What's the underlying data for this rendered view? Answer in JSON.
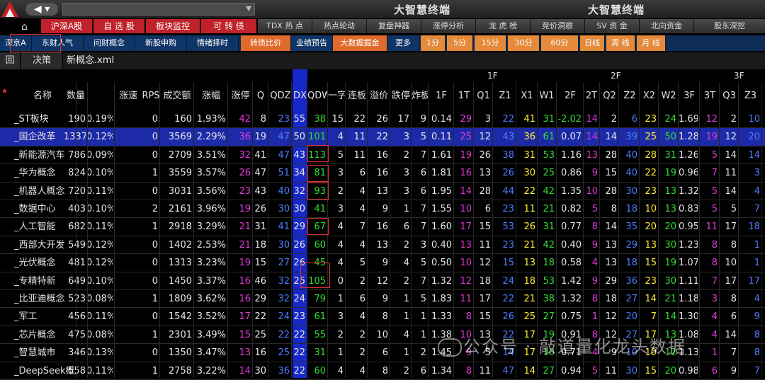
{
  "top": {
    "titles": [
      "大智慧终端",
      "大智慧终端"
    ]
  },
  "tabs_red": [
    "沪深A股",
    "自 选 股",
    "板块监控",
    "可 转 债"
  ],
  "tabs_dark": [
    "TDX 热 点",
    "热点轮动",
    "复盘神器",
    "涨停分析",
    "龙 虎 榜",
    "竞价洞察",
    "SV 资 金",
    "北向资金",
    "股东深挖"
  ],
  "row3": [
    "深京A",
    "东财人气",
    "问财概念",
    "新股申购",
    "情绪择时",
    "转债比价",
    "业绩预告",
    "大数据掘金",
    "更多",
    "1分",
    "5分",
    "15分",
    "30分",
    "60分",
    "日线",
    "周 线",
    "月 线"
  ],
  "row4": {
    "back": "回",
    "decide": "决策",
    "file": "新概念.xml"
  },
  "groups": [
    "1F",
    "2F",
    "3F"
  ],
  "headers": [
    "名称",
    "数量",
    "涨速",
    "RPS",
    "成交额",
    "涨幅",
    "涨停",
    "Q",
    "QDZ",
    "DX",
    "QDW",
    "一字",
    "连板",
    "溢价",
    "跌停",
    "炸板",
    "1F",
    "1T",
    "Q1",
    "Z1",
    "X1",
    "W1",
    "2F",
    "2T",
    "Q2",
    "Z2",
    "X2",
    "W2",
    "3F",
    "3T",
    "Q3",
    "Z3"
  ],
  "rows": [
    [
      "_ST板块",
      "190",
      "0.19%",
      "0",
      "160",
      "1.93%",
      "42",
      "8",
      "23",
      "55",
      "38",
      "15",
      "22",
      "26",
      "17",
      "9",
      "0.14",
      "29",
      "3",
      "22",
      "41",
      "31",
      "-2.02",
      "14",
      "2",
      "6",
      "23",
      "24",
      "1.69",
      "12",
      "2",
      "10"
    ],
    [
      "_国企改革",
      "1337",
      "0.12%",
      "0",
      "3569",
      "2.29%",
      "36",
      "19",
      "47",
      "50",
      "101",
      "4",
      "11",
      "22",
      "3",
      "5",
      "0.11",
      "25",
      "12",
      "43",
      "36",
      "61",
      "0.07",
      "14",
      "14",
      "39",
      "25",
      "50",
      "1.28",
      "19",
      "12",
      "20"
    ],
    [
      "_新能源汽车",
      "786",
      "0.09%",
      "0",
      "2709",
      "3.51%",
      "32",
      "41",
      "47",
      "43",
      "113",
      "5",
      "11",
      "16",
      "2",
      "7",
      "1.61",
      "19",
      "26",
      "38",
      "31",
      "53",
      "1.16",
      "13",
      "28",
      "40",
      "28",
      "31",
      "1.26",
      "5",
      "14",
      "14"
    ],
    [
      "_华为概念",
      "824",
      "0.10%",
      "1",
      "3559",
      "3.57%",
      "26",
      "47",
      "51",
      "34",
      "81",
      "3",
      "6",
      "16",
      "3",
      "6",
      "1.81",
      "16",
      "13",
      "26",
      "30",
      "25",
      "0.86",
      "9",
      "15",
      "40",
      "22",
      "19",
      "0.96",
      "7",
      "11",
      "3"
    ],
    [
      "_机器人概念",
      "720",
      "0.11%",
      "0",
      "3031",
      "3.56%",
      "23",
      "43",
      "40",
      "32",
      "93",
      "2",
      "4",
      "13",
      "3",
      "6",
      "1.95",
      "14",
      "28",
      "44",
      "22",
      "42",
      "1.35",
      "10",
      "28",
      "30",
      "23",
      "13",
      "1.32",
      "5",
      "14",
      "4"
    ],
    [
      "_数据中心",
      "403",
      "0.10%",
      "2",
      "2161",
      "3.96%",
      "19",
      "26",
      "30",
      "30",
      "41",
      "3",
      "4",
      "9",
      "1",
      "7",
      "1.55",
      "10",
      "6",
      "23",
      "11",
      "21",
      "0.82",
      "5",
      "8",
      "18",
      "10",
      "13",
      "0.83",
      "5",
      "5",
      "7"
    ],
    [
      "_人工智能",
      "682",
      "0.11%",
      "1",
      "2918",
      "3.29%",
      "21",
      "31",
      "41",
      "29",
      "67",
      "4",
      "7",
      "16",
      "6",
      "7",
      "1.60",
      "17",
      "15",
      "53",
      "26",
      "31",
      "0.77",
      "8",
      "14",
      "35",
      "20",
      "20",
      "0.95",
      "11",
      "17",
      "18"
    ],
    [
      "_西部大开发",
      "549",
      "0.12%",
      "0",
      "1402",
      "2.53%",
      "21",
      "18",
      "30",
      "26",
      "60",
      "4",
      "4",
      "13",
      "2",
      "3",
      "0.40",
      "13",
      "11",
      "23",
      "21",
      "42",
      "0.40",
      "9",
      "13",
      "29",
      "13",
      "30",
      "1.23",
      "8",
      "8",
      "1"
    ],
    [
      "_光伏概念",
      "481",
      "0.12%",
      "0",
      "1313",
      "3.23%",
      "19",
      "15",
      "27",
      "26",
      "45",
      "4",
      "5",
      "9",
      "4",
      "5",
      "0.50",
      "10",
      "12",
      "15",
      "13",
      "18",
      "0.58",
      "4",
      "13",
      "18",
      "15",
      "19",
      "1.07",
      "8",
      "10",
      "1"
    ],
    [
      "_专精特新",
      "649",
      "0.10%",
      "0",
      "1450",
      "3.37%",
      "16",
      "46",
      "32",
      "25",
      "105",
      "0",
      "2",
      "12",
      "2",
      "7",
      "1.32",
      "12",
      "18",
      "24",
      "18",
      "53",
      "1.42",
      "9",
      "29",
      "36",
      "23",
      "30",
      "1.11",
      "7",
      "17",
      "17"
    ],
    [
      "_比亚迪概念",
      "523",
      "0.08%",
      "1",
      "1809",
      "3.62%",
      "16",
      "29",
      "32",
      "24",
      "79",
      "1",
      "6",
      "9",
      "1",
      "5",
      "1.83",
      "11",
      "17",
      "22",
      "21",
      "38",
      "1.32",
      "8",
      "18",
      "27",
      "14",
      "21",
      "1.18",
      "3",
      "8",
      "4"
    ],
    [
      "_军工",
      "456",
      "0.11%",
      "0",
      "1542",
      "3.52%",
      "17",
      "22",
      "24",
      "23",
      "61",
      "3",
      "4",
      "8",
      "1",
      "1",
      "1.33",
      "8",
      "15",
      "26",
      "25",
      "27",
      "0.75",
      "1",
      "12",
      "20",
      "7",
      "14",
      "1.30",
      "4",
      "6",
      "9"
    ],
    [
      "_芯片概念",
      "475",
      "0.08%",
      "1",
      "2301",
      "3.49%",
      "15",
      "25",
      "22",
      "22",
      "55",
      "2",
      "2",
      "10",
      "4",
      "1",
      "1.38",
      "10",
      "13",
      "22",
      "17",
      "19",
      "0.91",
      "8",
      "12",
      "27",
      "17",
      "13",
      "1.08",
      "4",
      "14",
      "8"
    ],
    [
      "_智慧城市",
      "346",
      "0.13%",
      "0",
      "1350",
      "3.47%",
      "13",
      "16",
      "25",
      "22",
      "31",
      "1",
      "2",
      "6",
      "1",
      "2",
      "1.45",
      "9",
      "5",
      "14",
      "17",
      "10",
      "0.71",
      "4",
      "9",
      "10",
      "10",
      "12",
      "1.13",
      "1",
      "7",
      "8"
    ],
    [
      "_DeepSeek概念",
      "558",
      "0.11%",
      "1",
      "2758",
      "3.22%",
      "14",
      "30",
      "36",
      "22",
      "60",
      "4",
      "4",
      "8",
      "2",
      "6",
      "1.34",
      "8",
      "11",
      "47",
      "14",
      "27",
      "0.94",
      "5",
      "11",
      "30",
      "15",
      "20",
      "0.98",
      "6",
      "9",
      "7"
    ]
  ],
  "watermark": "公众号 · 敲道量化龙头数据",
  "colors": {
    "up": "#ff3b3b",
    "down": "#33dd33",
    "limit": "#e23bd8",
    "dx_bg": "#1628c8",
    "selected_bg": "#1d2aa8",
    "highlight_box": "#e23030"
  }
}
